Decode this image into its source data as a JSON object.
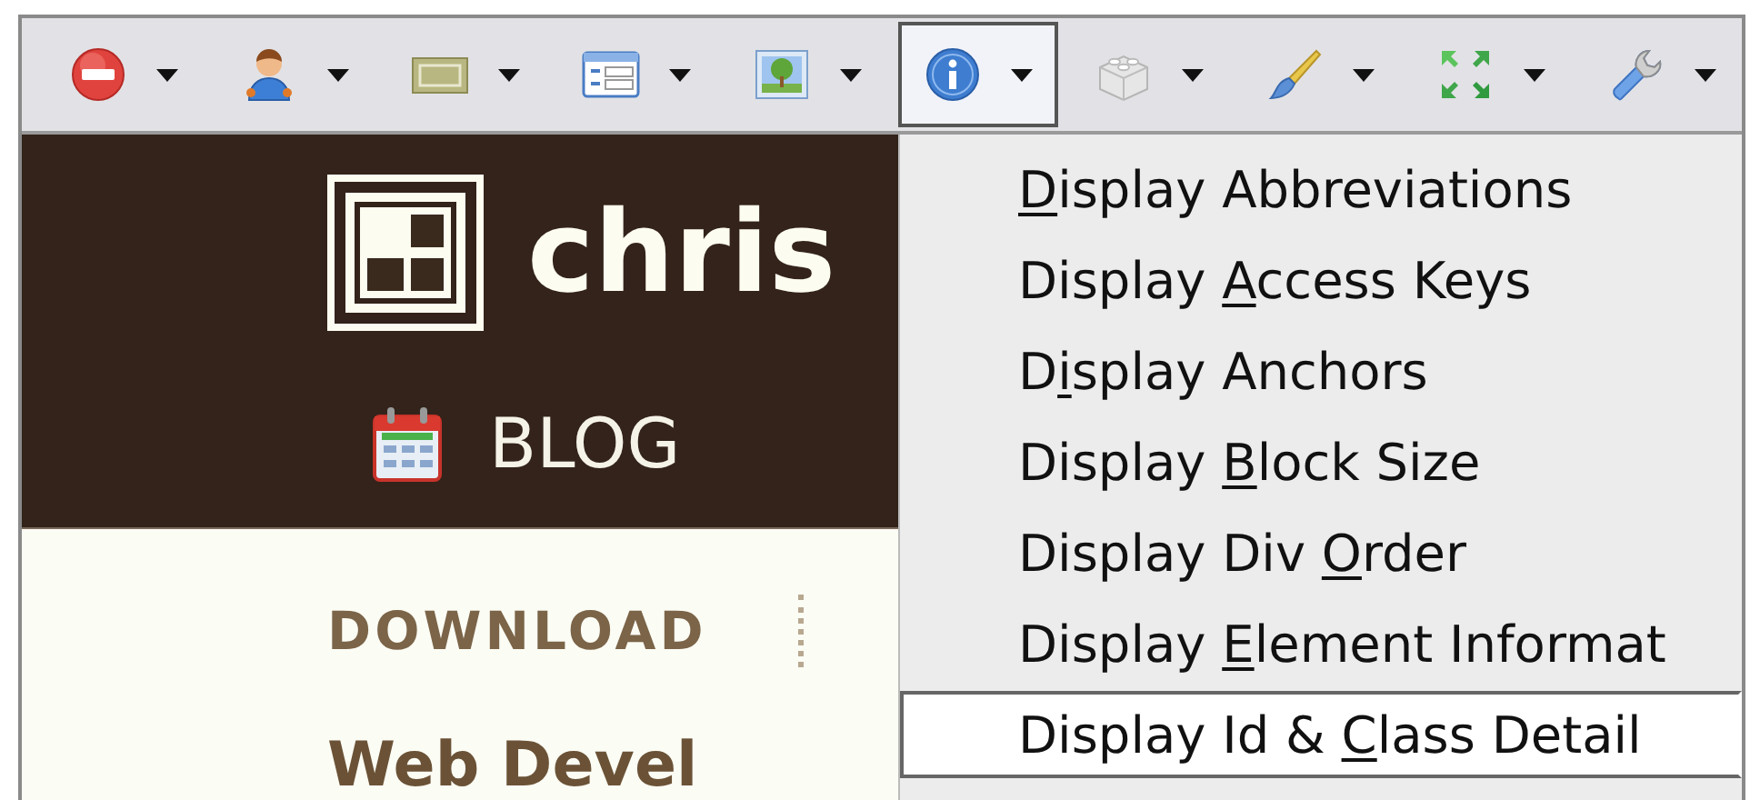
{
  "toolbar": {
    "buttons": [
      {
        "kind": "disable",
        "selected": false
      },
      {
        "kind": "cookies",
        "selected": false
      },
      {
        "kind": "css",
        "selected": false
      },
      {
        "kind": "forms",
        "selected": false
      },
      {
        "kind": "images",
        "selected": false
      },
      {
        "kind": "information",
        "selected": true
      },
      {
        "kind": "miscellaneous",
        "selected": false
      },
      {
        "kind": "outline",
        "selected": false
      },
      {
        "kind": "resize",
        "selected": false
      },
      {
        "kind": "tools",
        "selected": false
      }
    ]
  },
  "site_header": {
    "logo_text": "chris",
    "nav_item": "BLOG"
  },
  "site_nav": {
    "item": "DOWNLOAD"
  },
  "page_heading": "Web Devel",
  "menu": {
    "items": [
      {
        "mnemonic": "D",
        "label_end": "isplay Abbreviations",
        "selected": false
      },
      {
        "label_start": "Display ",
        "mnemonic": "A",
        "label_end": "ccess Keys",
        "selected": false
      },
      {
        "label_start": "D",
        "mnemonic": "i",
        "label_end": "splay Anchors",
        "selected": false
      },
      {
        "label_start": "Display ",
        "mnemonic": "B",
        "label_end": "lock Size",
        "selected": false
      },
      {
        "label_start": "Display Div ",
        "mnemonic": "O",
        "label_end": "rder",
        "selected": false
      },
      {
        "label_start": "Display ",
        "mnemonic": "E",
        "label_end": "lement Informat",
        "selected": false
      },
      {
        "label_start": "Display Id & ",
        "mnemonic": "C",
        "label_end": "lass Detail",
        "selected": true
      }
    ]
  }
}
